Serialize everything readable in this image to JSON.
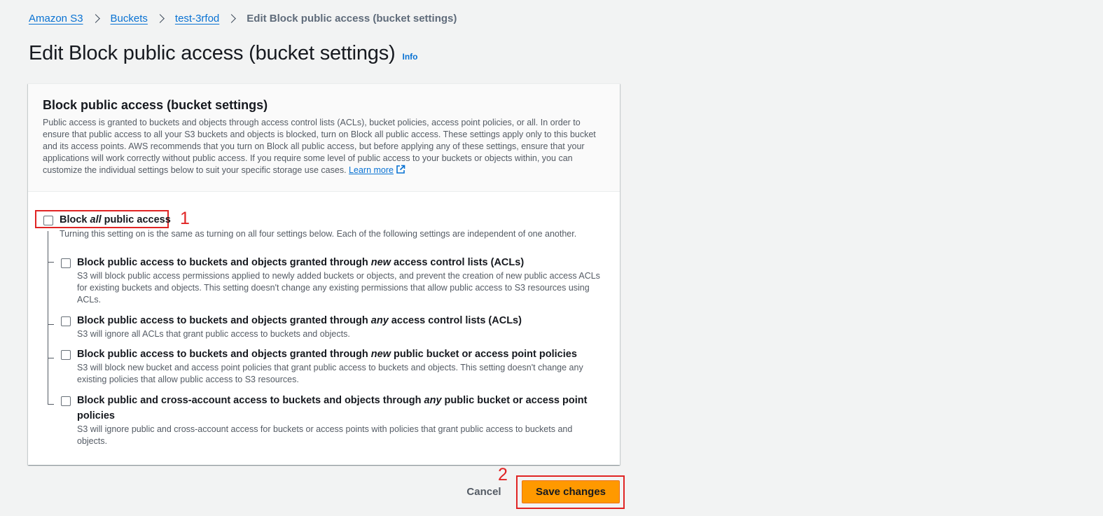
{
  "breadcrumb": {
    "items": [
      {
        "label": "Amazon S3"
      },
      {
        "label": "Buckets"
      },
      {
        "label": "test-3rfod"
      }
    ],
    "current": "Edit Block public access (bucket settings)"
  },
  "page": {
    "title": "Edit Block public access (bucket settings)",
    "info_label": "Info"
  },
  "card": {
    "title": "Block public access (bucket settings)",
    "description": "Public access is granted to buckets and objects through access control lists (ACLs), bucket policies, access point policies, or all. In order to ensure that public access to all your S3 buckets and objects is blocked, turn on Block all public access. These settings apply only to this bucket and its access points. AWS recommends that you turn on Block all public access, but before applying any of these settings, ensure that your applications will work correctly without public access. If you require some level of public access to your buckets or objects within, you can customize the individual settings below to suit your specific storage use cases.",
    "learn_more": "Learn more"
  },
  "main_option": {
    "label_prefix": "Block ",
    "label_em": "all",
    "label_suffix": " public access",
    "description": "Turning this setting on is the same as turning on all four settings below. Each of the following settings are independent of one another.",
    "checked": false
  },
  "sub_options": [
    {
      "label_prefix": "Block public access to buckets and objects granted through ",
      "label_em": "new",
      "label_suffix": " access control lists (ACLs)",
      "description": "S3 will block public access permissions applied to newly added buckets or objects, and prevent the creation of new public access ACLs for existing buckets and objects. This setting doesn't change any existing permissions that allow public access to S3 resources using ACLs.",
      "checked": false
    },
    {
      "label_prefix": "Block public access to buckets and objects granted through ",
      "label_em": "any",
      "label_suffix": " access control lists (ACLs)",
      "description": "S3 will ignore all ACLs that grant public access to buckets and objects.",
      "checked": false
    },
    {
      "label_prefix": "Block public access to buckets and objects granted through ",
      "label_em": "new",
      "label_suffix": " public bucket or access point policies",
      "description": "S3 will block new bucket and access point policies that grant public access to buckets and objects. This setting doesn't change any existing policies that allow public access to S3 resources.",
      "checked": false
    },
    {
      "label_prefix": "Block public and cross-account access to buckets and objects through ",
      "label_em": "any",
      "label_suffix": " public bucket or access point policies",
      "description": "S3 will ignore public and cross-account access for buckets or access points with policies that grant public access to buckets and objects.",
      "checked": false
    }
  ],
  "footer": {
    "cancel_label": "Cancel",
    "save_label": "Save changes"
  },
  "annotations": {
    "step1": "1",
    "step2": "2"
  },
  "colors": {
    "link": "#0972d3",
    "primary_button": "#ff9900",
    "annotation": "#e02424",
    "background": "#f2f3f3"
  }
}
